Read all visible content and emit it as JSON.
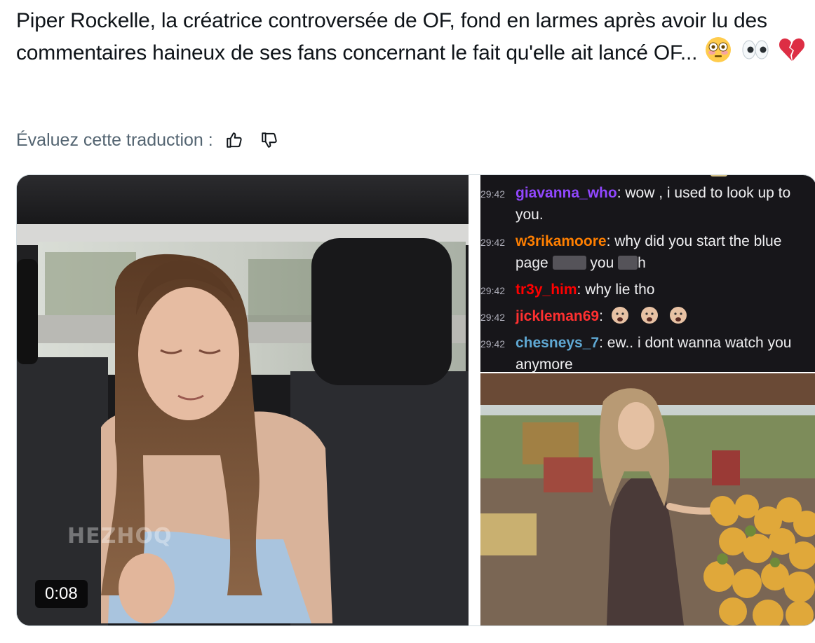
{
  "tweet": {
    "text": "Piper Rockelle, la créatrice controversée de OF, fond en larmes après avoir lu des commentaires haineux de ses fans concernant le fait qu'elle ait lancé OF...",
    "emojis": [
      "flushed-face-icon",
      "eyes-icon",
      "broken-heart-icon"
    ]
  },
  "translation": {
    "label": "Évaluez cette traduction :",
    "thumbs_up_icon": "thumbs-up-icon",
    "thumbs_down_icon": "thumbs-down-icon"
  },
  "media": {
    "video": {
      "duration": "0:08",
      "watermark": "HEZHOQ"
    },
    "chat": {
      "messages": [
        {
          "time": "29:42",
          "user": "giavanna_who",
          "color": "#9147ff",
          "text": ": wow , i used to look up to you."
        },
        {
          "time": "29:42",
          "user": "w3rikamoore",
          "color": "#ff7f00",
          "text_before": ": why did you start the blue page ",
          "text_after": " you ",
          "text_end": "h"
        },
        {
          "time": "29:42",
          "user": "tr3y_him",
          "color": "#ff0000",
          "text": ": why lie tho"
        },
        {
          "time": "29:42",
          "user": "jickleman69",
          "color": "#ff3030",
          "text": ":"
        },
        {
          "time": "29:42",
          "user": "chesneys_7",
          "color": "#5fa8d3",
          "text": ": ew.. i dont wanna watch you anymore"
        }
      ]
    }
  },
  "colors": {
    "text": "#0f1419",
    "secondary": "#536471",
    "border": "#cfd9de"
  }
}
